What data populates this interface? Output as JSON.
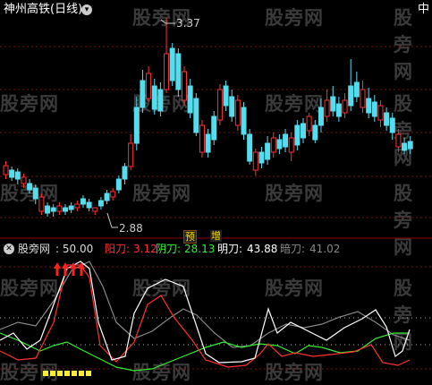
{
  "main_panel": {
    "title": "神州高铁(日线)",
    "menu_icon": "chevron-down-icon",
    "corner_label": "中",
    "high_label": "3.37",
    "low_label": "2.88",
    "badges": [
      {
        "text": "预",
        "color": "#ffdd00"
      },
      {
        "text": "增",
        "color": "#ffdd00"
      }
    ],
    "up_color": "#ff3333",
    "down_color": "#55ddee"
  },
  "indicator_panel": {
    "name": "股旁网",
    "value": ": 50.00",
    "items": [
      {
        "label": "阳刀:",
        "value": "3.12",
        "color": "#ff3030"
      },
      {
        "label": "阴刀:",
        "value": "28.13",
        "color": "#33ee33"
      },
      {
        "label": "明刀:",
        "value": "43.88",
        "color": "#ffffff"
      },
      {
        "label": "暗刀:",
        "value": "41.02",
        "color": "#888888"
      }
    ],
    "close_icon": "circle-x-icon"
  },
  "watermark": "股旁网"
}
